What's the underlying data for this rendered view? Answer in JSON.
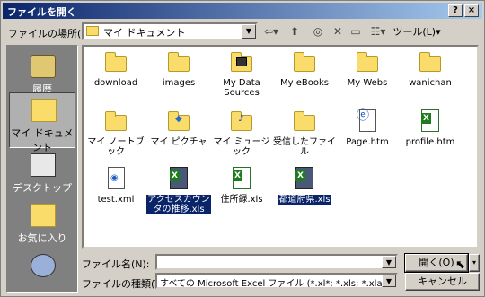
{
  "window": {
    "title": "ファイルを開く",
    "help_button": "?",
    "close_button": "×"
  },
  "toolbar": {
    "location_label": "ファイルの場所(I):",
    "location_value": "マイ ドキュメント",
    "tools_label": "ツール(L)"
  },
  "places": [
    {
      "label": "履歴",
      "icon": "history-icon"
    },
    {
      "label": "マイ ドキュメント",
      "icon": "my-documents-icon",
      "selected": true
    },
    {
      "label": "デスクトップ",
      "icon": "desktop-icon"
    },
    {
      "label": "お気に入り",
      "icon": "favorites-icon"
    },
    {
      "label": "",
      "icon": "network-icon"
    }
  ],
  "files": [
    {
      "name": "download",
      "type": "folder"
    },
    {
      "name": "images",
      "type": "folder"
    },
    {
      "name": "My Data Sources",
      "type": "special-folder"
    },
    {
      "name": "My eBooks",
      "type": "folder"
    },
    {
      "name": "My Webs",
      "type": "folder"
    },
    {
      "name": "wanichan",
      "type": "folder"
    },
    {
      "name": "マイ ノートブック",
      "type": "folder"
    },
    {
      "name": "マイ ピクチャ",
      "type": "pictures-folder"
    },
    {
      "name": "マイ ミュージック",
      "type": "music-folder"
    },
    {
      "name": "受信したファイル",
      "type": "folder"
    },
    {
      "name": "Page.htm",
      "type": "html"
    },
    {
      "name": "profile.htm",
      "type": "excel-html"
    },
    {
      "name": "test.xml",
      "type": "xml"
    },
    {
      "name": "アクセスカウンタの推移.xls",
      "type": "excel",
      "selected": true
    },
    {
      "name": "住所録.xls",
      "type": "excel"
    },
    {
      "name": "都道府県.xls",
      "type": "excel",
      "selected": true
    }
  ],
  "bottom": {
    "filename_label": "ファイル名(N):",
    "filename_value": "",
    "filetype_label": "ファイルの種類(T):",
    "filetype_value": "すべての Microsoft Excel ファイル (*.xl*; *.xls; *.xla; *.xlt;",
    "open_button": "開く(O)",
    "cancel_button": "キャンセル"
  },
  "colors": {
    "selection": "#0a246a",
    "folder": "#f9dc6a",
    "excel": "#1e7b1e"
  }
}
